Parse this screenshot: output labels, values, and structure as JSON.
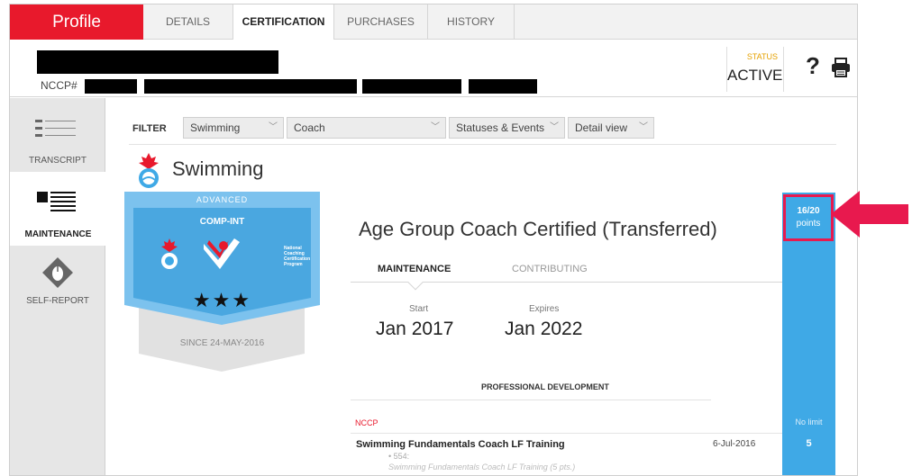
{
  "tabs": {
    "profile": "Profile",
    "details": "DETAILS",
    "certification": "CERTIFICATION",
    "purchases": "PURCHASES",
    "history": "HISTORY"
  },
  "header": {
    "nccp_label": "NCCP#",
    "status_label": "STATUS",
    "status_value": "ACTIVE",
    "help_icon": "question-mark",
    "print_icon": "printer"
  },
  "sidebar": {
    "items": [
      {
        "label": "TRANSCRIPT",
        "icon": "list-lines-icon"
      },
      {
        "label": "MAINTENANCE",
        "icon": "list-bars-icon"
      },
      {
        "label": "SELF-REPORT",
        "icon": "diamond-mouse-icon"
      }
    ]
  },
  "filter": {
    "label": "FILTER",
    "sport": "Swimming",
    "role": "Coach",
    "statuses": "Statuses & Events",
    "view": "Detail view"
  },
  "sport_title": "Swimming",
  "badge": {
    "level": "ADVANCED",
    "comp": "COMP-INT",
    "stars": "★★★",
    "program_text": "National Coaching Certification Program",
    "since": "SINCE 24-MAY-2016",
    "color": "#4aa7e0"
  },
  "certification": {
    "title": "Age Group Coach Certified (Transferred)",
    "tab_maintenance": "MAINTENANCE",
    "tab_contributing": "CONTRIBUTING",
    "start_label": "Start",
    "start_value": "Jan 2017",
    "expires_label": "Expires",
    "expires_value": "Jan 2022"
  },
  "professional_development": {
    "title": "PROFESSIONAL DEVELOPMENT",
    "section": "NCCP",
    "course_name": "Swimming Fundamentals Coach LF Training",
    "course_date": "6-Jul-2016",
    "course_code": "• 554:",
    "course_detail": "Swimming Fundamentals Coach LF Training (5 pts.)"
  },
  "points": {
    "value": "16/20",
    "label": "points",
    "no_limit": "No limit",
    "earned": "5",
    "column_color": "#3fa9e6",
    "highlight_color": "#e8194e"
  }
}
